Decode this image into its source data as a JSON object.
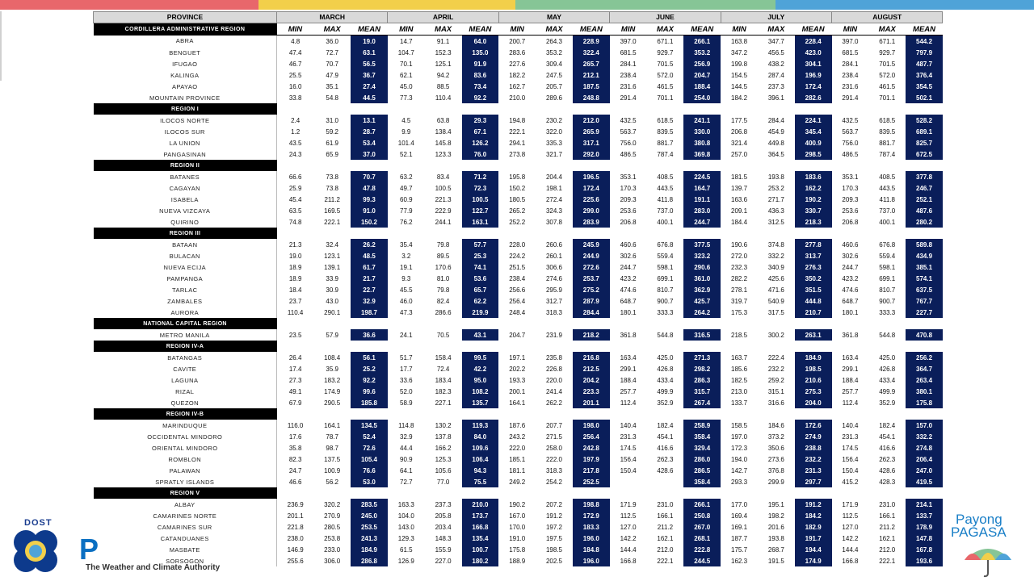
{
  "colors": {
    "top_bar": [
      "#e8676b",
      "#f2cf4a",
      "#86c596",
      "#4fa3d8"
    ],
    "mean_fill": "#0a1e5a",
    "region_fill": "#000000",
    "header_fill": "#d9d9d9"
  },
  "header": {
    "province_label": "PROVINCE",
    "first_region": "CORDILLERA ADMINISTRATIVE REGION",
    "months": [
      "MARCH",
      "APRIL",
      "MAY",
      "JUNE",
      "JULY",
      "AUGUST"
    ],
    "sub": [
      "MIN",
      "MAX",
      "MEAN"
    ]
  },
  "rows": [
    {
      "p": "ABRA",
      "v": [
        "4.8",
        "36.0",
        "19.0",
        "14.7",
        "91.1",
        "64.0",
        "200.7",
        "264.3",
        "228.9",
        "397.0",
        "671.1",
        "266.1",
        "163.8",
        "347.7",
        "228.4",
        "397.0",
        "671.1",
        "544.2"
      ]
    },
    {
      "p": "BENGUET",
      "v": [
        "47.4",
        "72.7",
        "63.1",
        "104.7",
        "152.3",
        "135.0",
        "283.6",
        "353.2",
        "322.4",
        "681.5",
        "929.7",
        "353.2",
        "347.2",
        "456.5",
        "423.0",
        "681.5",
        "929.7",
        "797.9"
      ]
    },
    {
      "p": "IFUGAO",
      "v": [
        "46.7",
        "70.7",
        "56.5",
        "70.1",
        "125.1",
        "91.9",
        "227.6",
        "309.4",
        "265.7",
        "284.1",
        "701.5",
        "256.9",
        "199.8",
        "438.2",
        "304.1",
        "284.1",
        "701.5",
        "487.7"
      ]
    },
    {
      "p": "KALINGA",
      "v": [
        "25.5",
        "47.9",
        "36.7",
        "62.1",
        "94.2",
        "83.6",
        "182.2",
        "247.5",
        "212.1",
        "238.4",
        "572.0",
        "204.7",
        "154.5",
        "287.4",
        "196.9",
        "238.4",
        "572.0",
        "376.4"
      ]
    },
    {
      "p": "APAYAO",
      "v": [
        "16.0",
        "35.1",
        "27.4",
        "45.0",
        "88.5",
        "73.4",
        "162.7",
        "205.7",
        "187.5",
        "231.6",
        "461.5",
        "188.4",
        "144.5",
        "237.3",
        "172.4",
        "231.6",
        "461.5",
        "354.5"
      ]
    },
    {
      "p": "MOUNTAIN PROVINCE",
      "v": [
        "33.8",
        "54.8",
        "44.5",
        "77.3",
        "110.4",
        "92.2",
        "210.0",
        "289.6",
        "248.8",
        "291.4",
        "701.1",
        "254.0",
        "184.2",
        "396.1",
        "282.6",
        "291.4",
        "701.1",
        "502.1"
      ]
    },
    {
      "region": "REGION I"
    },
    {
      "p": "ILOCOS NORTE",
      "v": [
        "2.4",
        "31.0",
        "13.1",
        "4.5",
        "63.8",
        "29.3",
        "194.8",
        "230.2",
        "212.0",
        "432.5",
        "618.5",
        "241.1",
        "177.5",
        "284.4",
        "224.1",
        "432.5",
        "618.5",
        "528.2"
      ]
    },
    {
      "p": "ILOCOS SUR",
      "v": [
        "1.2",
        "59.2",
        "28.7",
        "9.9",
        "138.4",
        "67.1",
        "222.1",
        "322.0",
        "265.9",
        "563.7",
        "839.5",
        "330.0",
        "206.8",
        "454.9",
        "345.4",
        "563.7",
        "839.5",
        "689.1"
      ]
    },
    {
      "p": "LA UNION",
      "v": [
        "43.5",
        "61.9",
        "53.4",
        "101.4",
        "145.8",
        "126.2",
        "294.1",
        "335.3",
        "317.1",
        "756.0",
        "881.7",
        "380.8",
        "321.4",
        "449.8",
        "400.9",
        "756.0",
        "881.7",
        "825.7"
      ]
    },
    {
      "p": "PANGASINAN",
      "v": [
        "24.3",
        "65.9",
        "37.0",
        "52.1",
        "123.3",
        "76.0",
        "273.8",
        "321.7",
        "292.0",
        "486.5",
        "787.4",
        "369.8",
        "257.0",
        "364.5",
        "298.5",
        "486.5",
        "787.4",
        "672.5"
      ]
    },
    {
      "region": "REGION II"
    },
    {
      "p": "BATANES",
      "v": [
        "66.6",
        "73.8",
        "70.7",
        "63.2",
        "83.4",
        "71.2",
        "195.8",
        "204.4",
        "196.5",
        "353.1",
        "408.5",
        "224.5",
        "181.5",
        "193.8",
        "183.6",
        "353.1",
        "408.5",
        "377.8"
      ]
    },
    {
      "p": "CAGAYAN",
      "v": [
        "25.9",
        "73.8",
        "47.8",
        "49.7",
        "100.5",
        "72.3",
        "150.2",
        "198.1",
        "172.4",
        "170.3",
        "443.5",
        "164.7",
        "139.7",
        "253.2",
        "162.2",
        "170.3",
        "443.5",
        "246.7"
      ]
    },
    {
      "p": "ISABELA",
      "v": [
        "45.4",
        "211.2",
        "99.3",
        "60.9",
        "221.3",
        "100.5",
        "180.5",
        "272.4",
        "225.6",
        "209.3",
        "411.8",
        "191.1",
        "163.6",
        "271.7",
        "190.2",
        "209.3",
        "411.8",
        "252.1"
      ]
    },
    {
      "p": "NUEVA VIZCAYA",
      "v": [
        "63.5",
        "169.5",
        "91.0",
        "77.9",
        "222.9",
        "122.7",
        "265.2",
        "324.3",
        "299.0",
        "253.6",
        "737.0",
        "283.0",
        "209.1",
        "436.3",
        "330.7",
        "253.6",
        "737.0",
        "487.6"
      ]
    },
    {
      "p": "QUIRINO",
      "v": [
        "74.8",
        "222.1",
        "150.2",
        "76.2",
        "244.1",
        "163.1",
        "252.2",
        "307.8",
        "283.9",
        "206.8",
        "400.1",
        "244.7",
        "184.4",
        "312.5",
        "218.3",
        "206.8",
        "400.1",
        "280.2"
      ]
    },
    {
      "region": "REGION III"
    },
    {
      "p": "BATAAN",
      "v": [
        "21.3",
        "32.4",
        "26.2",
        "35.4",
        "79.8",
        "57.7",
        "228.0",
        "260.6",
        "245.9",
        "460.6",
        "676.8",
        "377.5",
        "190.6",
        "374.8",
        "277.8",
        "460.6",
        "676.8",
        "589.8"
      ]
    },
    {
      "p": "BULACAN",
      "v": [
        "19.0",
        "123.1",
        "48.5",
        "3.2",
        "89.5",
        "25.3",
        "224.2",
        "260.1",
        "244.9",
        "302.6",
        "559.4",
        "323.2",
        "272.0",
        "332.2",
        "313.7",
        "302.6",
        "559.4",
        "434.9"
      ]
    },
    {
      "p": "NUEVA ECIJA",
      "v": [
        "18.9",
        "139.1",
        "61.7",
        "19.1",
        "170.6",
        "74.1",
        "251.5",
        "306.6",
        "272.6",
        "244.7",
        "598.1",
        "290.6",
        "232.3",
        "340.9",
        "276.3",
        "244.7",
        "598.1",
        "385.1"
      ]
    },
    {
      "p": "PAMPANGA",
      "v": [
        "18.9",
        "33.9",
        "21.7",
        "9.3",
        "81.0",
        "53.6",
        "238.4",
        "274.6",
        "253.7",
        "423.2",
        "699.1",
        "361.0",
        "282.2",
        "425.6",
        "350.2",
        "423.2",
        "699.1",
        "574.1"
      ]
    },
    {
      "p": "TARLAC",
      "v": [
        "18.4",
        "30.9",
        "22.7",
        "45.5",
        "79.8",
        "65.7",
        "256.6",
        "295.9",
        "275.2",
        "474.6",
        "810.7",
        "362.9",
        "278.1",
        "471.6",
        "351.5",
        "474.6",
        "810.7",
        "637.5"
      ]
    },
    {
      "p": "ZAMBALES",
      "v": [
        "23.7",
        "43.0",
        "32.9",
        "46.0",
        "82.4",
        "62.2",
        "256.4",
        "312.7",
        "287.9",
        "648.7",
        "900.7",
        "425.7",
        "319.7",
        "540.9",
        "444.8",
        "648.7",
        "900.7",
        "767.7"
      ]
    },
    {
      "p": "AURORA",
      "v": [
        "110.4",
        "290.1",
        "198.7",
        "47.3",
        "286.6",
        "219.9",
        "248.4",
        "318.3",
        "284.4",
        "180.1",
        "333.3",
        "264.2",
        "175.3",
        "317.5",
        "210.7",
        "180.1",
        "333.3",
        "227.7"
      ]
    },
    {
      "region": "NATIONAL CAPITAL REGION"
    },
    {
      "p": "METRO MANILA",
      "v": [
        "23.5",
        "57.9",
        "36.6",
        "24.1",
        "70.5",
        "43.1",
        "204.7",
        "231.9",
        "218.2",
        "361.8",
        "544.8",
        "316.5",
        "218.5",
        "300.2",
        "263.1",
        "361.8",
        "544.8",
        "470.8"
      ]
    },
    {
      "region": "REGION IV-A"
    },
    {
      "p": "BATANGAS",
      "v": [
        "26.4",
        "108.4",
        "56.1",
        "51.7",
        "158.4",
        "99.5",
        "197.1",
        "235.8",
        "216.8",
        "163.4",
        "425.0",
        "271.3",
        "163.7",
        "222.4",
        "184.9",
        "163.4",
        "425.0",
        "256.2"
      ]
    },
    {
      "p": "CAVITE",
      "v": [
        "17.4",
        "35.9",
        "25.2",
        "17.7",
        "72.4",
        "42.2",
        "202.2",
        "226.8",
        "212.5",
        "299.1",
        "426.8",
        "298.2",
        "185.6",
        "232.2",
        "198.5",
        "299.1",
        "426.8",
        "364.7"
      ]
    },
    {
      "p": "LAGUNA",
      "v": [
        "27.3",
        "183.2",
        "92.2",
        "33.6",
        "183.4",
        "95.0",
        "193.3",
        "220.0",
        "204.2",
        "188.4",
        "433.4",
        "286.3",
        "182.5",
        "259.2",
        "210.6",
        "188.4",
        "433.4",
        "263.4"
      ]
    },
    {
      "p": "RIZAL",
      "v": [
        "49.1",
        "174.9",
        "99.6",
        "52.0",
        "182.3",
        "108.2",
        "200.1",
        "241.4",
        "223.3",
        "257.7",
        "499.9",
        "315.7",
        "213.0",
        "315.1",
        "275.3",
        "257.7",
        "499.9",
        "380.1"
      ]
    },
    {
      "p": "QUEZON",
      "v": [
        "67.9",
        "290.5",
        "185.8",
        "58.9",
        "227.1",
        "135.7",
        "164.1",
        "262.2",
        "201.1",
        "112.4",
        "352.9",
        "267.4",
        "133.7",
        "316.6",
        "204.0",
        "112.4",
        "352.9",
        "175.8"
      ]
    },
    {
      "region": "REGION IV-B"
    },
    {
      "p": "MARINDUQUE",
      "v": [
        "116.0",
        "164.1",
        "134.5",
        "114.8",
        "130.2",
        "119.3",
        "187.6",
        "207.7",
        "198.0",
        "140.4",
        "182.4",
        "258.9",
        "158.5",
        "184.6",
        "172.6",
        "140.4",
        "182.4",
        "157.0"
      ]
    },
    {
      "p": "OCCIDENTAL MINDORO",
      "v": [
        "17.6",
        "78.7",
        "52.4",
        "32.9",
        "137.8",
        "84.0",
        "243.2",
        "271.5",
        "256.4",
        "231.3",
        "454.1",
        "358.4",
        "197.0",
        "373.2",
        "274.9",
        "231.3",
        "454.1",
        "332.2"
      ]
    },
    {
      "p": "ORIENTAL MINDORO",
      "v": [
        "35.8",
        "98.7",
        "72.6",
        "44.4",
        "166.2",
        "109.6",
        "222.0",
        "258.0",
        "242.8",
        "174.5",
        "416.6",
        "329.4",
        "172.3",
        "350.6",
        "238.8",
        "174.5",
        "416.6",
        "274.8"
      ]
    },
    {
      "p": "ROMBLON",
      "v": [
        "82.3",
        "137.5",
        "105.4",
        "90.9",
        "125.3",
        "106.4",
        "185.1",
        "222.0",
        "197.9",
        "156.4",
        "262.3",
        "286.0",
        "194.0",
        "273.6",
        "232.2",
        "156.4",
        "262.3",
        "206.4"
      ]
    },
    {
      "p": "PALAWAN",
      "v": [
        "24.7",
        "100.9",
        "76.6",
        "64.1",
        "105.6",
        "94.3",
        "181.1",
        "318.3",
        "217.8",
        "150.4",
        "428.6",
        "286.5",
        "142.7",
        "376.8",
        "231.3",
        "150.4",
        "428.6",
        "247.0"
      ]
    },
    {
      "p": "SPRATLY ISLANDS",
      "v": [
        "46.6",
        "56.2",
        "53.0",
        "72.7",
        "77.0",
        "75.5",
        "249.2",
        "254.2",
        "252.5",
        "",
        "",
        "358.4",
        "293.3",
        "299.9",
        "297.7",
        "415.2",
        "428.3",
        "419.5"
      ]
    },
    {
      "region": "REGION V"
    },
    {
      "p": "ALBAY",
      "v": [
        "236.9",
        "320.2",
        "283.5",
        "163.3",
        "237.3",
        "210.0",
        "190.2",
        "207.2",
        "198.8",
        "171.9",
        "231.0",
        "266.1",
        "177.0",
        "195.1",
        "191.2",
        "171.9",
        "231.0",
        "214.1"
      ]
    },
    {
      "p": "CAMARINES NORTE",
      "v": [
        "201.1",
        "270.9",
        "245.0",
        "104.0",
        "205.8",
        "173.7",
        "167.0",
        "191.2",
        "172.9",
        "112.5",
        "166.1",
        "250.8",
        "169.4",
        "198.2",
        "184.2",
        "112.5",
        "166.1",
        "133.7"
      ]
    },
    {
      "p": "CAMARINES SUR",
      "v": [
        "221.8",
        "280.5",
        "253.5",
        "143.0",
        "203.4",
        "166.8",
        "170.0",
        "197.2",
        "183.3",
        "127.0",
        "211.2",
        "267.0",
        "169.1",
        "201.6",
        "182.9",
        "127.0",
        "211.2",
        "178.9"
      ]
    },
    {
      "p": "CATANDUANES",
      "v": [
        "238.0",
        "253.8",
        "241.3",
        "129.3",
        "148.3",
        "135.4",
        "191.0",
        "197.5",
        "196.0",
        "142.2",
        "162.1",
        "268.1",
        "187.7",
        "193.8",
        "191.7",
        "142.2",
        "162.1",
        "147.8"
      ]
    },
    {
      "p": "MASBATE",
      "v": [
        "146.9",
        "233.0",
        "184.9",
        "61.5",
        "155.9",
        "100.7",
        "175.8",
        "198.5",
        "184.8",
        "144.4",
        "212.0",
        "222.8",
        "175.7",
        "268.7",
        "194.4",
        "144.4",
        "212.0",
        "167.8"
      ]
    },
    {
      "p": "SORSOGON",
      "v": [
        "255.6",
        "306.0",
        "286.8",
        "126.9",
        "227.0",
        "180.2",
        "188.9",
        "202.5",
        "196.0",
        "166.8",
        "222.1",
        "244.5",
        "162.3",
        "191.5",
        "174.9",
        "166.8",
        "222.1",
        "193.6"
      ]
    }
  ],
  "branding": {
    "dost": "DOST",
    "pa_letter": "P",
    "tagline": "The Weather and Climate Authority",
    "payong_line1": "Payong",
    "payong_line2": "PAGASA"
  }
}
